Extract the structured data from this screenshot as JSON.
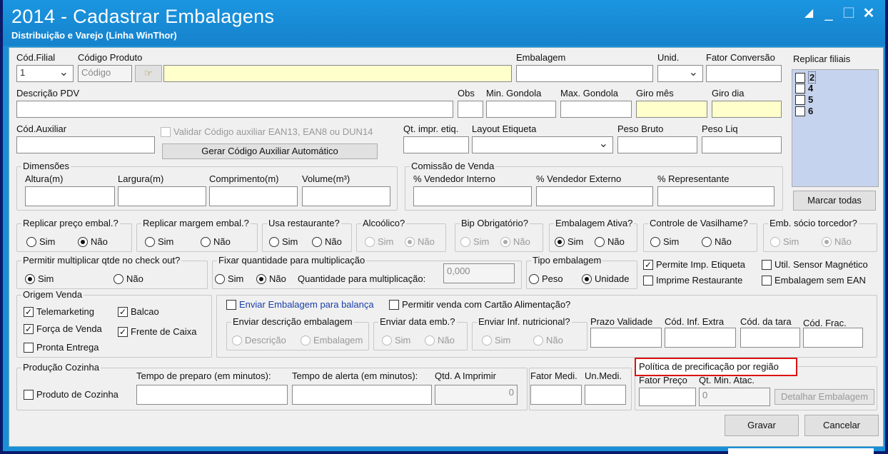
{
  "window": {
    "title": "2014 - Cadastrar Embalagens",
    "subtitle": "Distribuição e Varejo (Linha WinThor)"
  },
  "top": {
    "cod_filial_label": "Cód.Filial",
    "cod_filial_value": "1",
    "cod_produto_label": "Código Produto",
    "cod_produto_placeholder": "Código",
    "embalagem_label": "Embalagem",
    "unid_label": "Unid.",
    "fator_conv_label": "Fator Conversão",
    "replicar_filiais_label": "Replicar filiais",
    "filiais": [
      "2",
      "4",
      "5",
      "6"
    ],
    "marcar_todas": "Marcar todas"
  },
  "row2": {
    "descricao_pdv": "Descrição PDV",
    "obs": "Obs",
    "min_gondola": "Min. Gondola",
    "max_gondola": "Max. Gondola",
    "giro_mes": "Giro mês",
    "giro_dia": "Giro dia"
  },
  "row3": {
    "cod_auxiliar": "Cód.Auxiliar",
    "validar": "Validar Código auxiliar EAN13, EAN8 ou DUN14",
    "gerar": "Gerar Código Auxiliar Automático",
    "qt_impr": "Qt. impr. etiq.",
    "layout": "Layout Etiqueta",
    "peso_bruto": "Peso Bruto",
    "peso_liq": "Peso Liq"
  },
  "dimensoes": {
    "title": "Dimensões",
    "altura": "Altura(m)",
    "largura": "Largura(m)",
    "comprimento": "Comprimento(m)",
    "volume": "Volume(m³)"
  },
  "comissao": {
    "title": "Comissão de Venda",
    "interno": "% Vendedor Interno",
    "externo": "% Vendedor Externo",
    "representante": "% Representante"
  },
  "opts": {
    "sim": "Sim",
    "nao": "Não"
  },
  "radio_groups": {
    "replicar_preco": "Replicar preço embal.?",
    "replicar_margem": "Replicar margem embal.?",
    "usa_restaurante": "Usa restaurante?",
    "alcoolico": "Alcoólico?",
    "bip": "Bip Obrigatório?",
    "ativa": "Embalagem Ativa?",
    "vasilhame": "Controle de Vasilhame?",
    "socio": "Emb. sócio torcedor?",
    "multiplicar": "Permitir multiplicar qtde no check out?",
    "fixar": "Fixar quantidade para multiplicação",
    "qtd_mult": "Quantidade para multiplicação:",
    "qtd_mult_value": "0,000",
    "tipo": "Tipo embalagem",
    "peso": "Peso",
    "unidade": "Unidade"
  },
  "checks": {
    "imp_etiqueta": "Permite Imp. Etiqueta",
    "sensor": "Util. Sensor Magnético",
    "imprime_rest": "Imprime Restaurante",
    "sem_ean": "Embalagem sem EAN"
  },
  "origem": {
    "title": "Origem Venda",
    "telemarketing": "Telemarketing",
    "balcao": "Balcao",
    "forca": "Força de Venda",
    "frente": "Frente de Caixa",
    "pronta": "Pronta Entrega"
  },
  "balanca": {
    "enviar": "Enviar Embalagem para balança",
    "cartao": "Permitir venda com Cartão Alimentação?",
    "env_desc": "Enviar descrição embalagem",
    "descricao": "Descrição",
    "embalagem": "Embalagem",
    "env_data": "Enviar data emb.?",
    "env_inf": "Enviar Inf. nutricional?",
    "prazo": "Prazo Validade",
    "cod_inf": "Cód. Inf. Extra",
    "cod_tara": "Cód. da tara",
    "cod_frac": "Cód. Frac."
  },
  "producao": {
    "title": "Produção Cozinha",
    "produto": "Produto de Cozinha",
    "tempo_preparo": "Tempo de preparo (em minutos):",
    "tempo_alerta": "Tempo de alerta (em minutos):",
    "qtd_imprimir": "Qtd. A Imprimir",
    "qtd_value": "0"
  },
  "fator": {
    "fator_medi": "Fator Medi.",
    "un_medi": "Un.Medi."
  },
  "politica": {
    "title": "Política de precificação por região",
    "fator_preco": "Fator Preço",
    "qt_min": "Qt. Min. Atac.",
    "qt_min_value": "0",
    "detalhar": "Detalhar Embalagem"
  },
  "actions": {
    "gravar": "Gravar",
    "cancelar": "Cancelar"
  },
  "colors": {
    "title_bar": "#1682cc",
    "highlight": "#d11111"
  }
}
